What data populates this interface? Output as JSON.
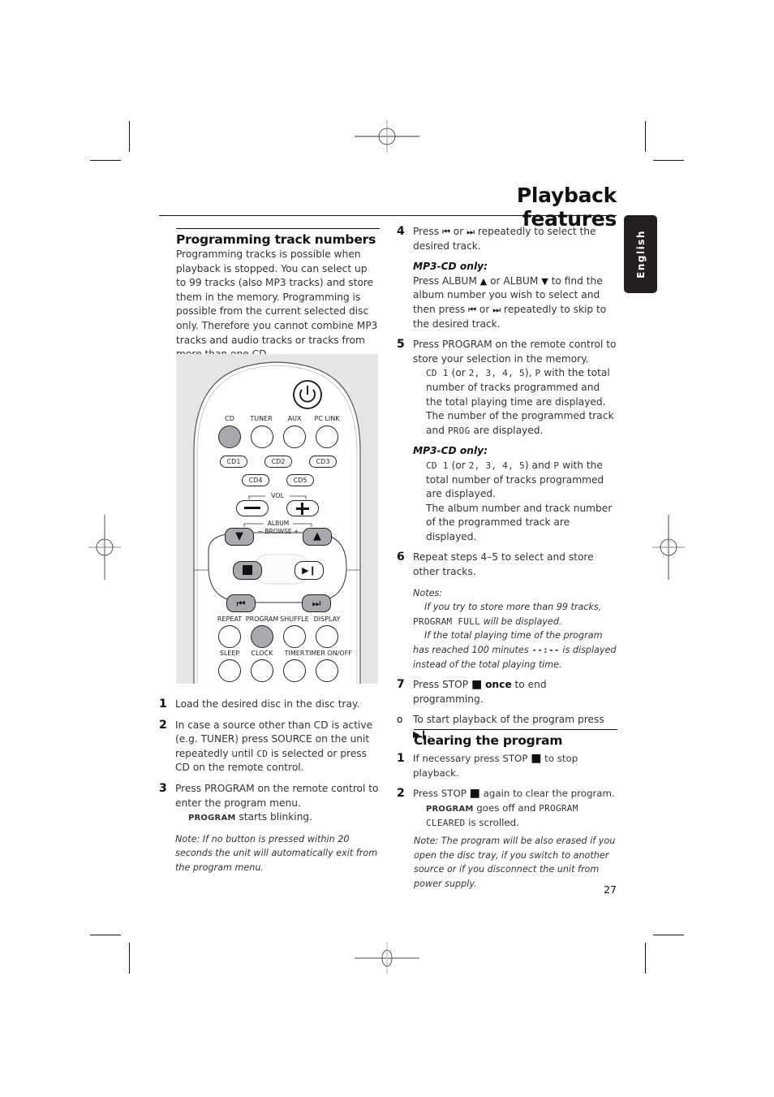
{
  "page": {
    "title": "Playback features",
    "language_tab": "English",
    "page_number": "27"
  },
  "left": {
    "heading": "Programming track numbers",
    "intro": "Programming tracks is possible when playback is stopped. You can select up to 99 tracks (also MP3 tracks) and store them in the memory. Programming is possible from the current selected disc only. Therefore you cannot combine MP3 tracks and audio tracks or tracks from more than one CD.",
    "steps": [
      {
        "num": "1",
        "text": "Load the desired disc in the disc tray."
      },
      {
        "num": "2",
        "pre": "In case a source other than CD is active (e.g. TUNER) press SOURCE on the unit repeatedly until ",
        "mono": "CD",
        "post": " is selected or press CD on the remote control."
      },
      {
        "num": "3",
        "text": "Press PROGRAM on the remote control to enter the program menu.",
        "indicator": "PROGRAM",
        "indicator_text": " starts blinking."
      }
    ],
    "note": "Note: If no button is pressed within 20 seconds the unit will automatically exit from the program menu."
  },
  "remote": {
    "source_labels": [
      "CD",
      "TUNER",
      "AUX",
      "PC LINK"
    ],
    "disc_buttons": [
      "CD1",
      "CD2",
      "CD3",
      "CD4",
      "CD5"
    ],
    "vol_label": "VOL",
    "album_label": "ALBUM",
    "browse_label": "BROWSE",
    "minus": "−",
    "plus": "+",
    "row1_labels": [
      "REPEAT",
      "PROGRAM",
      "SHUFFLE",
      "DISPLAY"
    ],
    "row2_labels": [
      "SLEEP",
      "CLOCK",
      "TIMER",
      "TIMER ON/OFF"
    ],
    "highlight_color": "#a7a9ac"
  },
  "right": {
    "step4": {
      "num": "4",
      "a": "Press ",
      "b": " or ",
      "c": " repeatedly to select the desired track."
    },
    "mp3_label": "MP3-CD only:",
    "step4_mp3": {
      "a": "Press ALBUM ",
      "b": " or ALBUM ",
      "c": " to find the album number you wish to select and then press ",
      "d": " or ",
      "e": " repeatedly to skip to the desired track."
    },
    "step5": {
      "num": "5",
      "text": "Press PROGRAM on the remote control to store your selection in the memory.",
      "d1_mono": "CD 1",
      "d1_a": " (or ",
      "d1_nums": "2, 3, 4, 5",
      "d1_b": "), ",
      "d1_p": "P",
      "d1_c": " with the total number of tracks programmed and the total playing time are displayed.",
      "d2_a": "The number of the programmed track and ",
      "d2_mono": "PROG",
      "d2_b": " are displayed."
    },
    "step5_mp3": {
      "d1_mono": "CD 1",
      "d1_a": " (or ",
      "d1_nums": "2, 3, 4, 5",
      "d1_b": ") and ",
      "d1_p": "P",
      "d1_c": " with the total number of tracks programmed are displayed.",
      "d2": "The album number and track number of the programmed track are displayed."
    },
    "step6": {
      "num": "6",
      "text": "Repeat steps 4–5 to select and store other tracks."
    },
    "notes": {
      "label": "Notes:",
      "n1_a": "If you try to store more than 99 tracks,",
      "n1_mono": "PROGRAM FULL",
      "n1_b": " will be displayed.",
      "n2_a": "If the total playing time of the program has reached 100 minutes ",
      "n2_mono": "--:--",
      "n2_b": " is displayed instead of the total playing time."
    },
    "step7": {
      "num": "7",
      "a": "Press STOP ",
      "bold": "once",
      "b": " to end programming."
    },
    "bullet": {
      "num": "o",
      "a": "To start playback of the program press ",
      "b": "."
    },
    "clearing": {
      "heading": "Clearing the program",
      "s1": {
        "num": "1",
        "a": "If necessary press STOP ",
        "b": " to stop playback."
      },
      "s2": {
        "num": "2",
        "a": "Press STOP ",
        "b": " again to clear the program.",
        "ind": "PROGRAM",
        "c": " goes off and ",
        "mono": "PROGRAM CLEARED",
        "d": " is scrolled."
      },
      "note": "Note: The program will be also erased if you open the disc tray, if you switch to another source or if you disconnect the unit from power supply."
    }
  },
  "glyphs": {
    "prev": "⏮",
    "next": "⏭",
    "up": "▲",
    "down": "▼",
    "stop": "■",
    "playpause": "▶❙"
  }
}
